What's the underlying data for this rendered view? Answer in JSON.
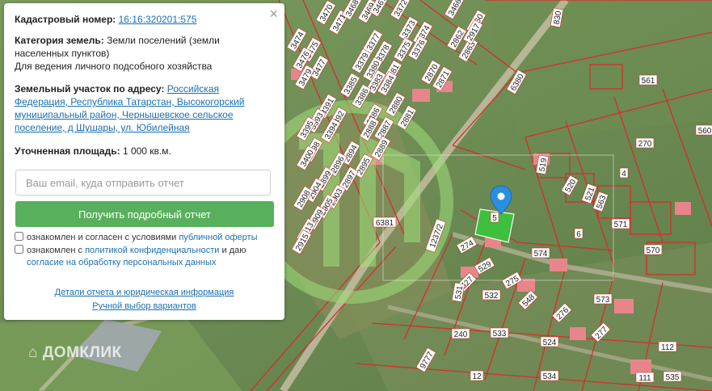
{
  "popup": {
    "cadastral_label": "Кадастровый номер:",
    "cadastral_number": "16:16:320201:575",
    "category_label": "Категория земель:",
    "category_value": "Земли поселений (земли населенных пунктов)",
    "use_value": "Для ведения личного подсобного хозяйства",
    "address_label": "Земельный участок по адресу:",
    "address_value": "Российская Федерация, Республика Татарстан, Высокогорский муниципальный район, Чернышевское сельское поселение, д Шушары, ул. Юбилейная",
    "area_label": "Уточненная площадь:",
    "area_value": "1 000 кв.м.",
    "email_placeholder": "Ваш email, куда отправить отчет",
    "report_button": "Получить подробный отчет",
    "consent1_text": "ознакомлен и согласен с условиями ",
    "consent1_link": "публичной оферты",
    "consent2_text1": "ознакомлен с ",
    "consent2_link1": "политикой конфиденциальности",
    "consent2_text2": " и даю",
    "consent2_link2": "согласие на обработку персональных данных",
    "details_link": "Детали отчета и юридическая информация",
    "manual_link": "Ручной выбор вариантов",
    "close_glyph": "×"
  },
  "map": {
    "selected_parcel": "575",
    "watermark": "ДОМКЛИК",
    "colors": {
      "parcel_border": "#d62d2d",
      "selected_fill": "#3cc23c",
      "marker": "#2b8fe0"
    },
    "labels": [
      "3470",
      "3471",
      "3468",
      "3469",
      "3467",
      "3466",
      "3474",
      "3475",
      "3476",
      "3477",
      "3479",
      "3372",
      "3373",
      "3374",
      "3375",
      "3376",
      "3377",
      "3378",
      "3379",
      "3380",
      "3381",
      "3383",
      "3384",
      "3385",
      "3386",
      "3391",
      "3392",
      "3393",
      "3394",
      "3395",
      "3398",
      "3400",
      "2880",
      "2881",
      "2886",
      "2887",
      "2888",
      "2889",
      "2894",
      "2895",
      "2896",
      "2897",
      "2899",
      "2903",
      "2904",
      "2905",
      "2908",
      "2909",
      "2913",
      "2915",
      "2870",
      "2871",
      "2862",
      "2863",
      "2860",
      "2917",
      "6380",
      "6381",
      "4",
      "5",
      "6",
      "12",
      "111",
      "112",
      "240",
      "270",
      "274",
      "275",
      "276",
      "277",
      "524",
      "527",
      "529",
      "531",
      "532",
      "533",
      "534",
      "535",
      "548",
      "561",
      "560",
      "570",
      "571",
      "573",
      "574",
      "519",
      "520",
      "521",
      "563",
      "830",
      "1237/2",
      "9777"
    ]
  }
}
